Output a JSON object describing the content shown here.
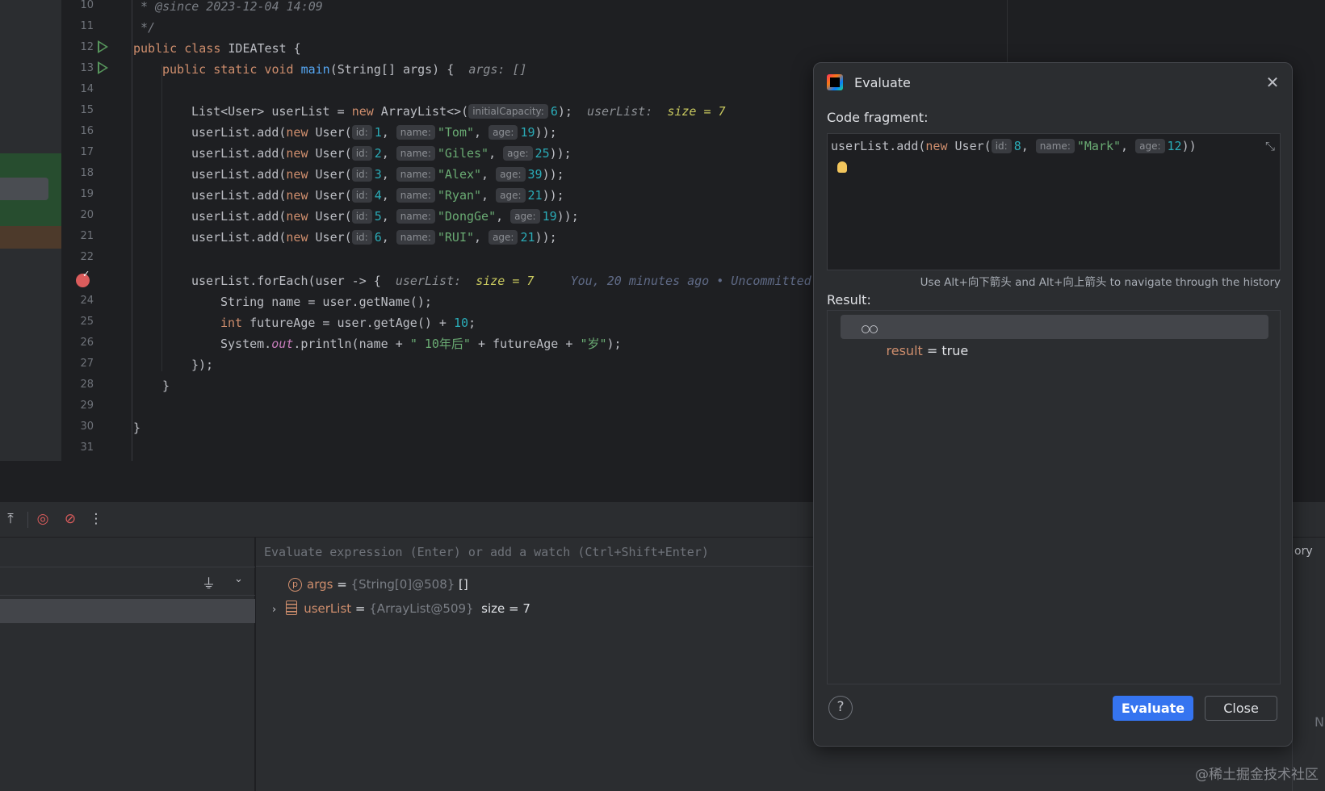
{
  "editor": {
    "line_numbers": [
      "10",
      "11",
      "12",
      "13",
      "14",
      "15",
      "16",
      "17",
      "18",
      "19",
      "20",
      "21",
      "22",
      "23",
      "24",
      "25",
      "26",
      "27",
      "28",
      "29",
      "30",
      "31"
    ],
    "javadoc_since": " * @since 2023-12-04 14:09",
    "javadoc_end": " */",
    "class_decl": {
      "kw": "public class",
      "name": " IDEATest {"
    },
    "main_decl": {
      "kw": "public static void",
      "fn": "main",
      "params": "(String[] args) {",
      "hint": "args: []"
    },
    "list_decl": {
      "lhs": "List<User> userList = ",
      "kw": "new",
      "rhs": " ArrayList<>(",
      "hint": "initialCapacity:",
      "num": "6",
      "end": ");",
      "inl_name": "userList:",
      "inl_val": "size = 7"
    },
    "adds": [
      {
        "id": "1",
        "name": "\"Tom\"",
        "age": "19"
      },
      {
        "id": "2",
        "name": "\"Giles\"",
        "age": "25"
      },
      {
        "id": "3",
        "name": "\"Alex\"",
        "age": "39"
      },
      {
        "id": "4",
        "name": "\"Ryan\"",
        "age": "21"
      },
      {
        "id": "5",
        "name": "\"DongGe\"",
        "age": "19"
      },
      {
        "id": "6",
        "name": "\"RUI\"",
        "age": "21"
      }
    ],
    "add_parts": {
      "prefix": "userList.add(",
      "kw": "new",
      "ctor": " User(",
      "id_hint": "id:",
      "name_hint": "name:",
      "age_hint": "age:",
      "sep": ", ",
      "end": "));"
    },
    "foreach": {
      "code": "userList.forEach(user -> {",
      "inl_name": "userList:",
      "inl_val": "size = 7",
      "blame": "You, 20 minutes ago • Uncommitted"
    },
    "line24": "String name = user.getName();",
    "line25": {
      "kw": "int",
      "code": " futureAge = user.getAge() + ",
      "num": "10",
      "end": ";"
    },
    "line26": {
      "a": "System.",
      "field": "out",
      "b": ".println(name + ",
      "s1": "\" 10年后\"",
      "c": " + futureAge + ",
      "s2": "\"岁\"",
      "d": ");"
    },
    "line27": "});",
    "line28": "}",
    "line30": "}"
  },
  "debugger": {
    "eval_placeholder": "Evaluate expression (Enter) or add a watch (Ctrl+Shift+Enter)",
    "variables": [
      {
        "name": "args",
        "eq": " = ",
        "type": "{String[0]@508}",
        "value": " []"
      },
      {
        "name": "userList",
        "eq": " = ",
        "type": "{ArrayList@509}",
        "value": "  size = 7"
      }
    ],
    "p_badge": "p",
    "side_tab": "ory",
    "side_n": "N"
  },
  "dialog": {
    "title": "Evaluate",
    "code_label": "Code fragment:",
    "code": {
      "prefix": "userList.add(",
      "kw": "new",
      "ctor": " User(",
      "id_hint": "id:",
      "id": "8",
      "name_hint": "name:",
      "name": "\"Mark\"",
      "age_hint": "age:",
      "age": "12",
      "end": ")"
    },
    "history_hint": "Use Alt+向下箭头 and Alt+向上箭头 to navigate through the history",
    "result_label": "Result:",
    "result": {
      "name": "result",
      "eq": " = ",
      "value": "true"
    },
    "help_label": "?",
    "evaluate_label": "Evaluate",
    "close_label": "Close"
  },
  "watermark": "@稀土掘金技术社区",
  "colors": {
    "accent": "#3574f0",
    "highlight": "#214283",
    "breakpoint": "#db5c5c",
    "keyword": "#cf8e6d",
    "string": "#6aab73",
    "number": "#2aacb8",
    "function": "#56a8f5"
  }
}
